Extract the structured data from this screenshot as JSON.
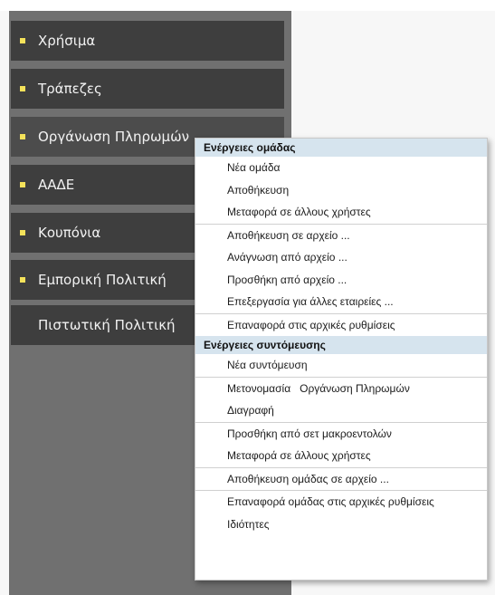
{
  "sidebar": {
    "items": [
      {
        "label": "Χρήσιμα",
        "bullet": true
      },
      {
        "label": "Τράπεζες",
        "bullet": true
      },
      {
        "label": "Οργάνωση Πληρωμών",
        "bullet": true
      },
      {
        "label": "ΑΑΔΕ",
        "bullet": true
      },
      {
        "label": "Κουπόνια",
        "bullet": true
      },
      {
        "label": "Εμπορική Πολιτική",
        "bullet": true
      },
      {
        "label": "Πιστωτική Πολιτική",
        "bullet": false
      }
    ]
  },
  "context_menu": {
    "group_header": "Ενέργειες ομάδας",
    "group_items": [
      "Νέα ομάδα",
      "Αποθήκευση",
      "Μεταφορά σε άλλους χρήστες",
      "Αποθήκευση σε αρχείο ...",
      "Ανάγνωση από αρχείο ...",
      "Προσθήκη από αρχείο ...",
      "Επεξεργασία για άλλες εταιρείες ...",
      "Επαναφορά στις αρχικές ρυθμίσεις"
    ],
    "shortcut_header": "Ενέργειες συντόμευσης",
    "shortcut_items": [
      "Νέα συντόμευση",
      "Μετονομασία   Οργάνωση Πληρωμών",
      "Διαγραφή",
      "Προσθήκη από σετ μακροεντολών",
      "Μεταφορά σε άλλους χρήστες",
      "Αποθήκευση ομάδας σε αρχείο ...",
      "Επαναφορά ομάδας στις αρχικές ρυθμίσεις",
      "Ιδιότητες"
    ]
  },
  "colors": {
    "sidebar_bg": "#707070",
    "nav_item_bg": "#3e3e3e",
    "bullet": "#f4e25a",
    "menu_header_bg": "#d6e4ee"
  }
}
